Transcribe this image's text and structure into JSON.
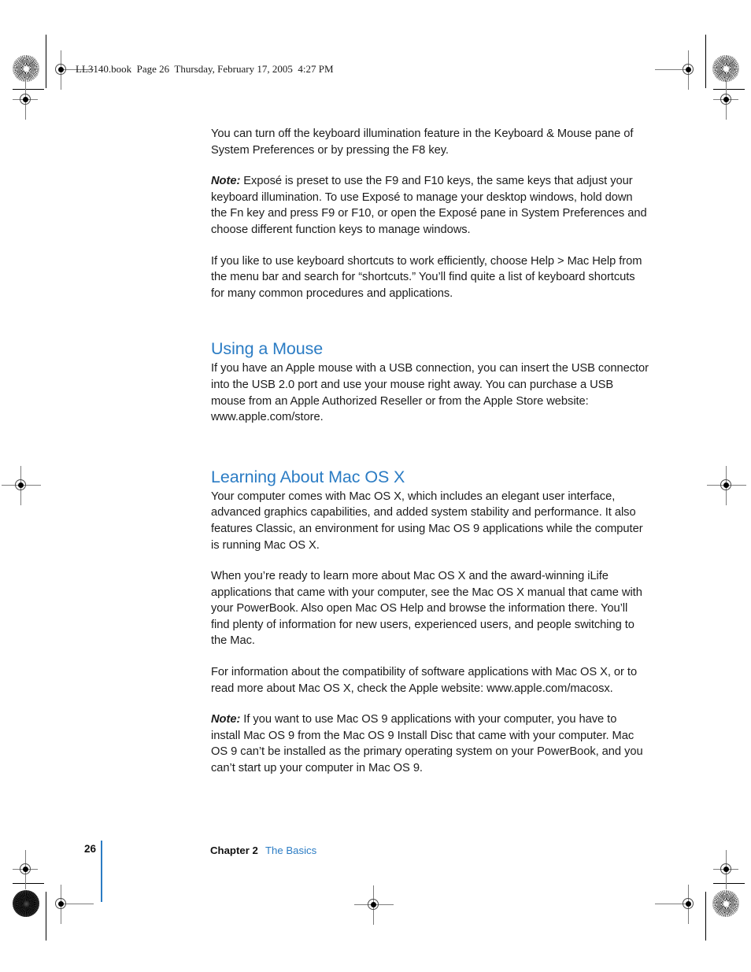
{
  "document": {
    "running_header": "LL3140.book  Page 26  Thursday, February 17, 2005  4:27 PM",
    "page_number": "26",
    "footer_chapter": "Chapter 2",
    "footer_title": "The Basics",
    "accent_color": "#2b7cc4",
    "text_color": "#1c1c1c"
  },
  "content": {
    "para_keyboard_illumination": "You can turn off the keyboard illumination feature in the Keyboard & Mouse pane of System Preferences or by pressing the F8 key.",
    "note_expose_label": "Note:",
    "note_expose_text": " Exposé is preset to use the F9 and F10 keys, the same keys that adjust your keyboard illumination. To use Exposé to manage your desktop windows, hold down the Fn key and press F9 or F10, or open the Exposé pane in System Preferences and choose different function keys to manage windows.",
    "para_shortcuts": "If you like to use keyboard shortcuts to work efficiently, choose Help > Mac Help from the menu bar and search for “shortcuts.” You’ll find quite a list of keyboard shortcuts for many common procedures and applications.",
    "heading_mouse": "Using a Mouse",
    "para_mouse": "If you have an Apple mouse with a USB connection, you can insert the USB connector into the USB 2.0 port and use your mouse right away. You can purchase a USB mouse from an Apple Authorized Reseller or from the Apple Store website: www.apple.com/store.",
    "heading_osx": "Learning About Mac OS X",
    "para_osx_intro": "Your computer comes with Mac OS X, which includes an elegant user interface, advanced graphics capabilities, and added system stability and performance. It also features Classic, an environment for using Mac OS 9 applications while the computer is running Mac OS X.",
    "para_osx_learn": "When you’re ready to learn more about Mac OS X and the award-winning iLife applications that came with your computer, see the Mac OS X manual that came with your PowerBook. Also open Mac OS Help and browse the information there. You’ll find plenty of information for new users, experienced users, and people switching to the Mac.",
    "para_osx_compat": "For information about the compatibility of software applications with Mac OS X, or to read more about Mac OS X, check the Apple website:  www.apple.com/macosx.",
    "note_os9_label": "Note:",
    "note_os9_text": "  If you want to use Mac OS 9 applications with your computer, you have to install Mac OS 9 from the Mac OS 9 Install Disc that came with your computer. Mac OS 9 can’t be installed as the primary operating system on your PowerBook, and you can’t start up your computer in Mac OS 9."
  }
}
